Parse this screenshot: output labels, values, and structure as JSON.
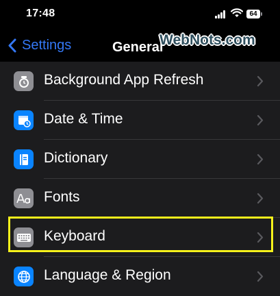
{
  "status": {
    "time": "17:48",
    "battery": "64"
  },
  "nav": {
    "back_label": "Settings",
    "title": "General"
  },
  "watermark": "WebNots.com",
  "settings_list": [
    {
      "label": "Background App Refresh",
      "icon": "refresh-gear-icon",
      "color": "#8e8e93"
    },
    {
      "label": "Date & Time",
      "icon": "calendar-clock-icon",
      "color": "#0a84ff"
    },
    {
      "label": "Dictionary",
      "icon": "book-icon",
      "color": "#0a84ff"
    },
    {
      "label": "Fonts",
      "icon": "aa-font-icon",
      "color": "#8e8e93"
    },
    {
      "label": "Keyboard",
      "icon": "keyboard-icon",
      "color": "#8e8e93"
    },
    {
      "label": "Language & Region",
      "icon": "globe-icon",
      "color": "#0a84ff"
    }
  ],
  "colors": {
    "accent": "#3478f6",
    "highlight": "#f6f21b",
    "background": "#000000"
  }
}
